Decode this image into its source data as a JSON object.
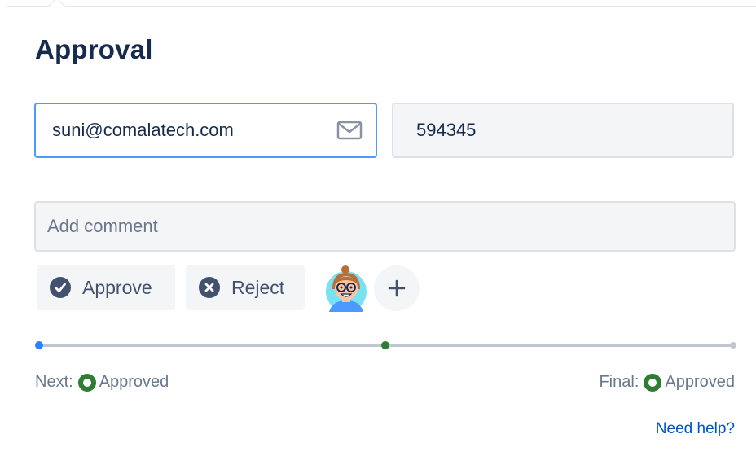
{
  "panel": {
    "title": "Approval"
  },
  "form": {
    "email_value": "suni@comalatech.com",
    "code_value": "594345",
    "comment_placeholder": "Add comment"
  },
  "actions": {
    "approve_label": "Approve",
    "reject_label": "Reject",
    "add_label": "+"
  },
  "progress": {
    "stages": 3,
    "current_stage": 1
  },
  "status": {
    "next_label": "Next:",
    "next_value": "Approved",
    "final_label": "Final:",
    "final_value": "Approved"
  },
  "help": {
    "label": "Need help?"
  },
  "icons": {
    "email": "envelope-icon",
    "approve": "check-circle-icon",
    "reject": "x-circle-icon",
    "status": "status-ring-icon"
  },
  "colors": {
    "focus_border": "#4c9aff",
    "approve_icon": "#42526e",
    "progress_start": "#2684ff",
    "progress_mid": "#36b37e",
    "status_green": "#2e7d32",
    "link": "#0052cc"
  }
}
